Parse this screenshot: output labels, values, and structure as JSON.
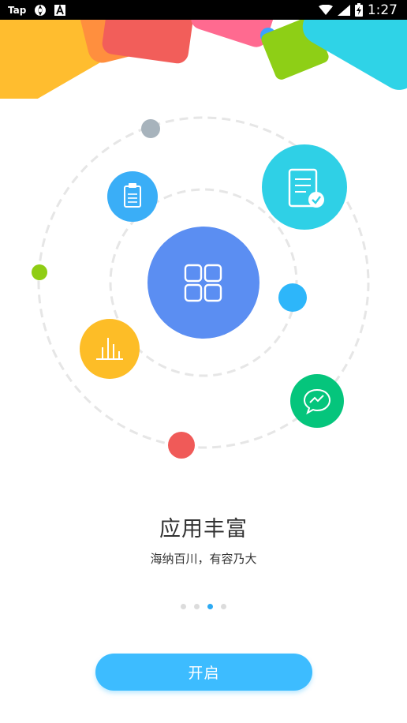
{
  "status_bar": {
    "tap_label": "Tap",
    "time": "1:27",
    "icons": [
      "aperture-icon",
      "a-box-icon",
      "wifi-icon",
      "signal-icon",
      "battery-charging-icon"
    ]
  },
  "onboarding": {
    "title": "应用丰富",
    "subtitle": "海纳百川，有容乃大",
    "page_count": 4,
    "active_page": 3,
    "start_button_label": "开启"
  },
  "colors": {
    "center": "#5b8ef2",
    "document": "#2fd0e6",
    "clipboard": "#3aaef7",
    "chart": "#fdbd27",
    "message": "#05c57c",
    "dot_gray": "#a7b3bc",
    "dot_green": "#8fcd14",
    "dot_blue": "#2db6fa",
    "dot_red": "#f05a58",
    "button": "#3dbcff",
    "indicator_active": "#2daaf3"
  }
}
